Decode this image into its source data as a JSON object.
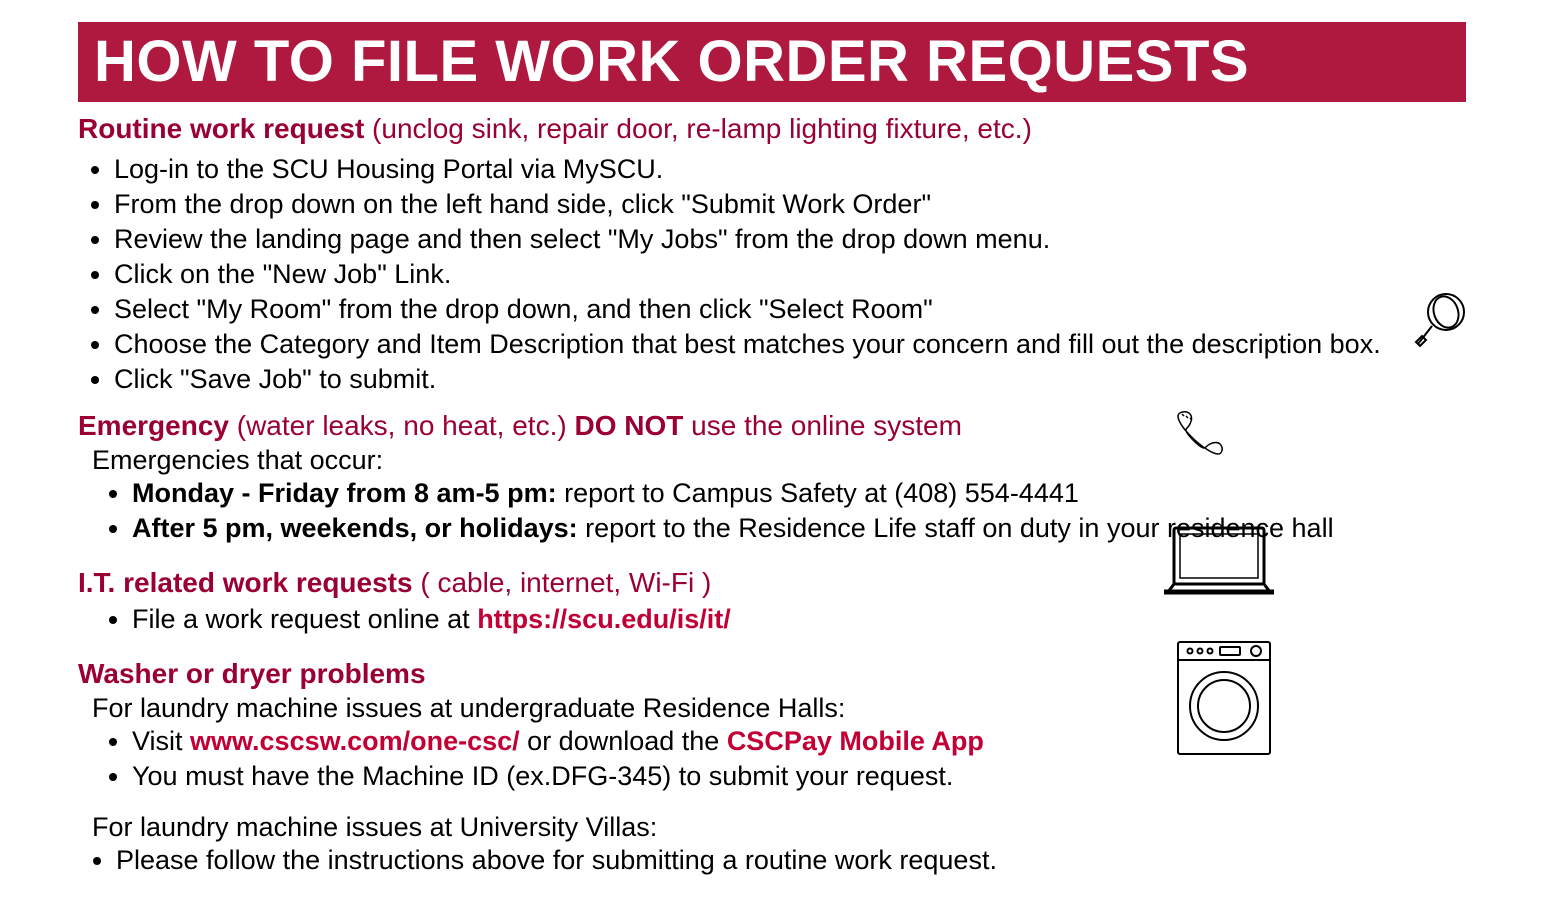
{
  "title": "HOW TO FILE WORK ORDER REQUESTS",
  "routine": {
    "lead": "Routine work request",
    "detail": " (unclog sink, repair door, re-lamp lighting fixture, etc.)",
    "steps": [
      "Log-in to the SCU Housing Portal via MySCU.",
      "From the drop down on the left hand side, click \"Submit Work Order\"",
      "Review the landing page and then select \"My Jobs\" from the drop down menu.",
      "Click on the \"New Job\" Link.",
      "Select \"My Room\" from the drop down, and then click \"Select Room\"",
      "Choose the Category and Item Description that best matches your concern and fill out the description box.",
      "Click \"Save Job\" to submit."
    ]
  },
  "emergency": {
    "lead": "Emergency",
    "detail1": " (water leaks, no heat, etc.) ",
    "donot": "DO NOT",
    "detail2": " use the online system",
    "intro": "Emergencies that occur:",
    "items": [
      {
        "bold": "Monday - Friday from 8 am-5 pm:",
        "rest": " report to Campus Safety at (408) 554-4441"
      },
      {
        "bold": "After 5 pm, weekends, or holidays:",
        "rest": " report to the Residence Life staff on duty in your residence hall"
      }
    ]
  },
  "it": {
    "lead": "I.T. related work requests",
    "detail": " ( cable, internet, Wi-Fi )",
    "step_pre": "File a work request online at ",
    "link": "https://scu.edu/is/it/"
  },
  "laundry": {
    "lead": "Washer or dryer problems",
    "intro": "For laundry machine issues at undergraduate Residence Halls:",
    "step1_pre": "Visit  ",
    "step1_link1": "www.cscsw.com/one-csc/",
    "step1_mid": " or download the ",
    "step1_link2": "CSCPay Mobile App",
    "step2": "You must have the Machine ID (ex.DFG-345) to submit your request.",
    "villas_intro": "For laundry machine issues at University Villas:",
    "villas_step": "Please follow the instructions above for submitting a routine work request."
  }
}
